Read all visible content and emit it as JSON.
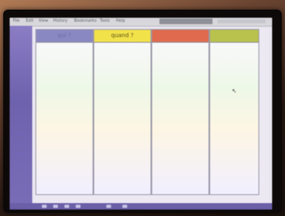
{
  "menubar": {
    "items": [
      "File",
      "Edit",
      "View",
      "History",
      "Bookmarks",
      "Tools",
      "Help"
    ],
    "url": "",
    "colors": {
      "bar": "#d8d8dc"
    }
  },
  "board": {
    "columns": [
      {
        "label": "qui ?",
        "color": "#8a88c2"
      },
      {
        "label": "quand ?",
        "color": "#f2e24a"
      },
      {
        "label": "",
        "color": "#e06a4e"
      },
      {
        "label": "",
        "color": "#b8c24c"
      }
    ]
  },
  "cursor": {
    "icon": "pointer-icon"
  }
}
